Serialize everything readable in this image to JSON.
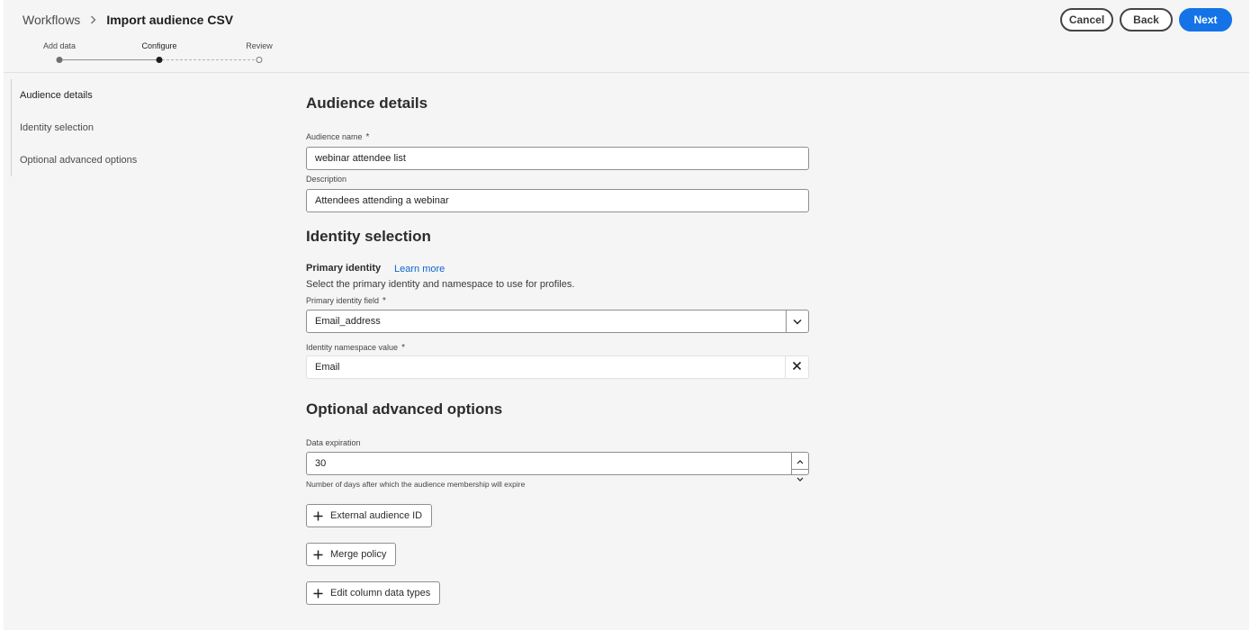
{
  "breadcrumb": {
    "parent": "Workflows",
    "current": "Import audience CSV"
  },
  "actions": {
    "cancel": "Cancel",
    "back": "Back",
    "next": "Next"
  },
  "stepper": {
    "steps": [
      {
        "label": "Add data",
        "state": "done"
      },
      {
        "label": "Configure",
        "state": "current"
      },
      {
        "label": "Review",
        "state": "todo"
      }
    ]
  },
  "nav": {
    "items": [
      {
        "label": "Audience details",
        "active": true
      },
      {
        "label": "Identity selection",
        "active": false
      },
      {
        "label": "Optional advanced options",
        "active": false
      }
    ]
  },
  "audience_details": {
    "title": "Audience details",
    "name_label": "Audience name",
    "name_value": "webinar attendee list",
    "description_label": "Description",
    "description_value": "Attendees attending a webinar"
  },
  "identity": {
    "title": "Identity selection",
    "primary_identity_label": "Primary identity",
    "learn_more": "Learn more",
    "help": "Select the primary identity and namespace to use for profiles.",
    "field_label": "Primary identity field",
    "field_value": "Email_address",
    "namespace_label": "Identity namespace value",
    "namespace_value": "Email"
  },
  "advanced": {
    "title": "Optional advanced options",
    "expiration_label": "Data expiration",
    "expiration_value": "30",
    "expiration_help": "Number of days after which the audience membership will expire",
    "external_id_button": "External audience ID",
    "merge_policy_button": "Merge policy",
    "edit_columns_button": "Edit column data types"
  },
  "required_marker": "*",
  "colors": {
    "accent": "#1473e6",
    "link": "#0d66d0",
    "background": "#f5f5f5"
  }
}
